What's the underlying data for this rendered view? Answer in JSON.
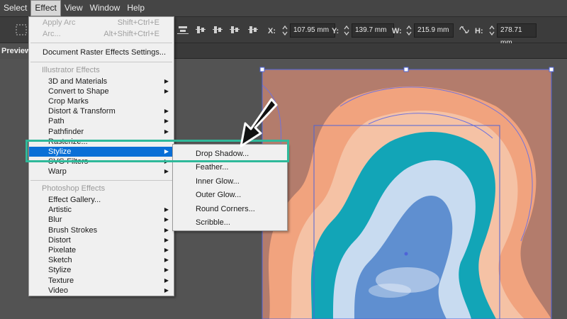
{
  "menubar": [
    "Select",
    "Effect",
    "View",
    "Window",
    "Help"
  ],
  "controlbar": {
    "x_label": "X:",
    "x_value": "107.95 mm",
    "y_label": "Y:",
    "y_value": "139.7 mm",
    "w_label": "W:",
    "w_value": "215.9 mm",
    "h_label": "H:",
    "h_value": "278.71 mm"
  },
  "doc_tab": "Preview)",
  "effect_menu": {
    "apply": "Apply Arc",
    "apply_sc": "Shift+Ctrl+E",
    "last": "Arc...",
    "last_sc": "Alt+Shift+Ctrl+E",
    "raster_settings": "Document Raster Effects Settings...",
    "illustrator_header": "Illustrator Effects",
    "illustrator_items": [
      "3D and Materials",
      "Convert to Shape",
      "Crop Marks",
      "Distort & Transform",
      "Path",
      "Pathfinder",
      "Rasterize...",
      "Stylize",
      "SVG Filters",
      "Warp"
    ],
    "photoshop_header": "Photoshop Effects",
    "photoshop_items": [
      "Effect Gallery...",
      "Artistic",
      "Blur",
      "Brush Strokes",
      "Distort",
      "Pixelate",
      "Sketch",
      "Stylize",
      "Texture",
      "Video"
    ]
  },
  "stylize_submenu": [
    "Drop Shadow...",
    "Feather...",
    "Inner Glow...",
    "Outer Glow...",
    "Round Corners...",
    "Scribble..."
  ],
  "colors": {
    "highlight": "#0a6fd6",
    "callout": "#2fb99a",
    "artboard": "#b37c6c",
    "teal": "#12a5b7",
    "peach": "#f1a37e",
    "sky": "#5f8fd0"
  }
}
